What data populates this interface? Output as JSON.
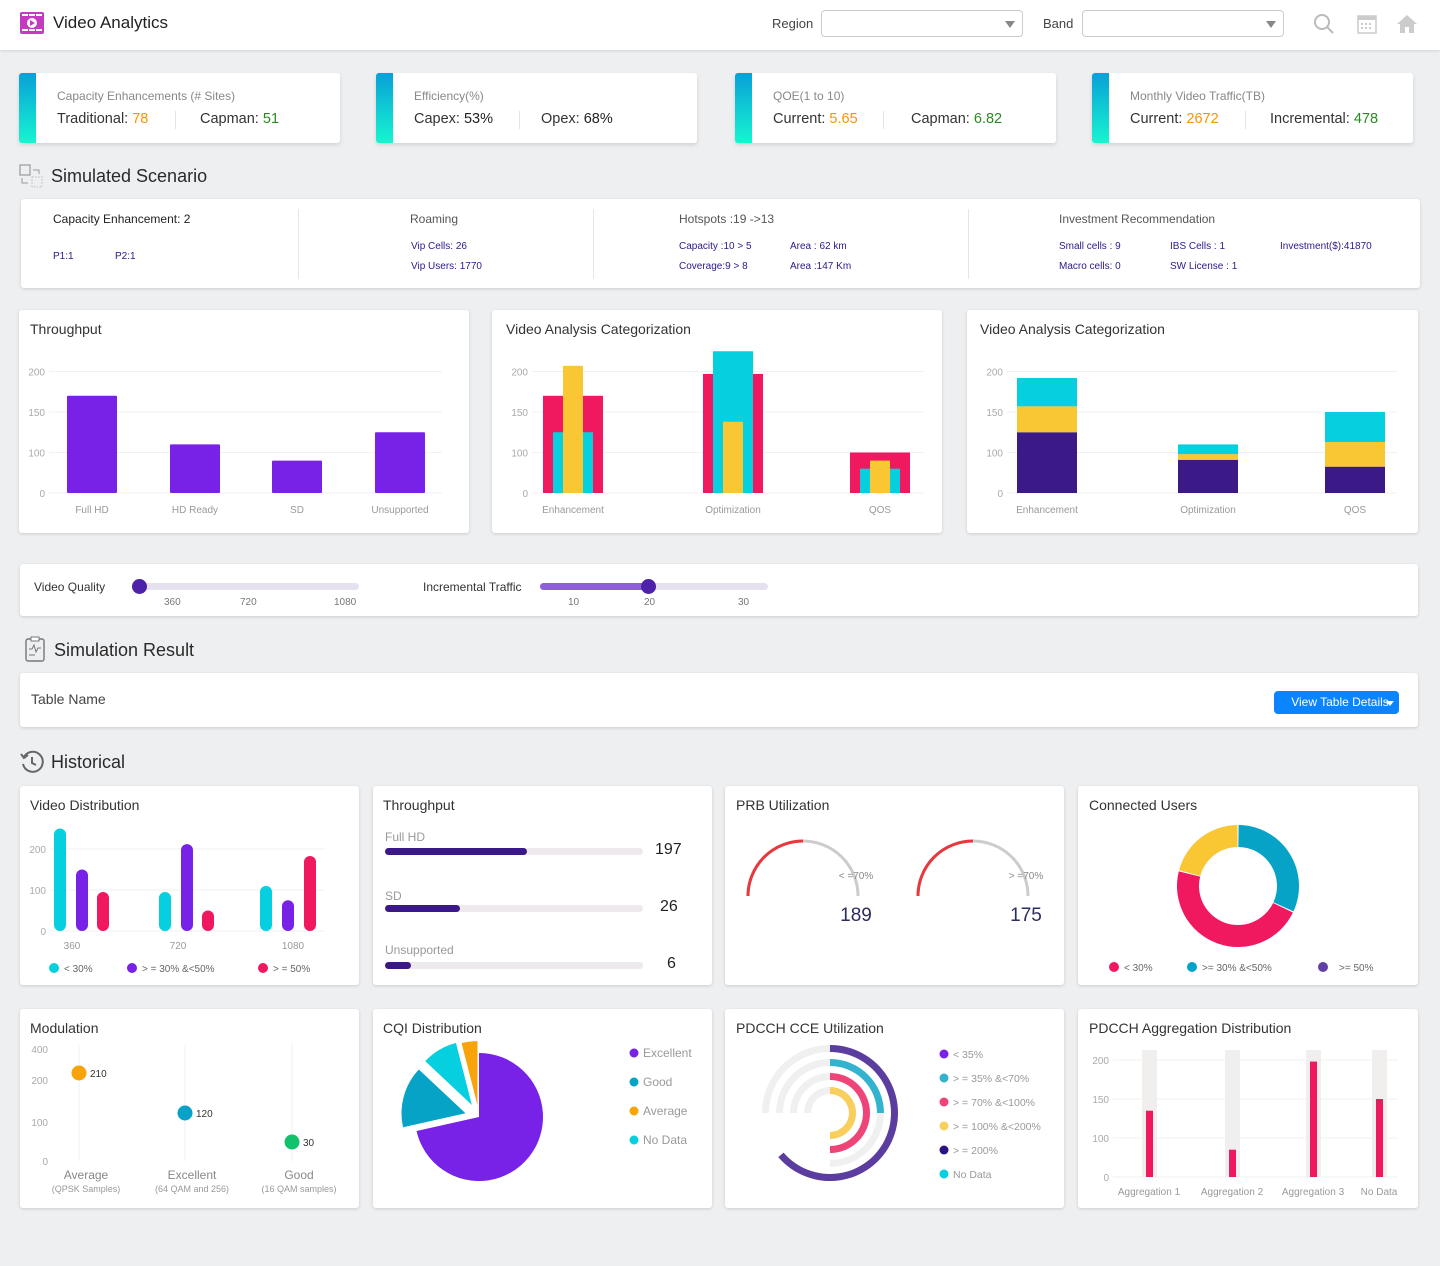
{
  "header": {
    "title": "Video Analytics",
    "region_label": "Region",
    "region_value": "",
    "band_label": "Band",
    "band_value": "",
    "icons": [
      "search-icon",
      "calendar-icon",
      "home-icon"
    ]
  },
  "kpis": [
    {
      "title": "Capacity Enhancements (# Sites)",
      "a_label": "Traditional:",
      "a_value": "78",
      "b_label": "Capman:",
      "b_value": "51"
    },
    {
      "title": "Efficiency(%)",
      "a_label": "Capex:",
      "a_value": "53%",
      "b_label": "Opex:",
      "b_value": "68%"
    },
    {
      "title": "QOE(1 to 10)",
      "a_label": "Current:",
      "a_value": "5.65",
      "b_label": "Capman:",
      "b_value": "6.82"
    },
    {
      "title": "Monthly Video Traffic(TB)",
      "a_label": "Current:",
      "a_value": "2672",
      "b_label": "Incremental:",
      "b_value": "478"
    }
  ],
  "colors": {
    "accent_orange": "#f7930a",
    "accent_green": "#2a8a1f",
    "purple": "#7722e6",
    "pink": "#f0195f",
    "cyan": "#06cfdf",
    "yellow": "#f9c634",
    "indigo": "#3b1a87",
    "button_blue": "#0a84ff"
  },
  "simulated": {
    "title": "Simulated Scenario",
    "capacity": {
      "heading": "Capacity Enhancement: 2",
      "p1": "P1:1",
      "p2": "P2:1"
    },
    "roaming": {
      "heading": "Roaming",
      "vip_cells": "Vip Cells: 26",
      "vip_users": "Vip Users: 1770"
    },
    "hotspots": {
      "heading": "Hotspots :19 ->13",
      "capacity": "Capacity :10 > 5",
      "area1": "Area : 62 km",
      "coverage": "Coverage:9 > 8",
      "area2": "Area :147 Km"
    },
    "investment": {
      "heading": "Investment Recommendation",
      "small": "Small cells : 9",
      "ibs": "IBS Cells : 1",
      "investment": "Investment($):41870",
      "macro": "Macro cells: 0",
      "sw": "SW License : 1"
    }
  },
  "sliders": {
    "video_quality": {
      "label": "Video Quality",
      "ticks": [
        "360",
        "720",
        "1080"
      ],
      "value_fraction": 0
    },
    "incremental_traffic": {
      "label": "Incremental Traffic",
      "ticks": [
        "10",
        "20",
        "30"
      ],
      "value": 20
    }
  },
  "simulation_result": {
    "title": "Simulation Result",
    "table_name": "Table Name",
    "button": "View Table Details"
  },
  "historical": {
    "title": "Historical"
  },
  "chart_data": [
    {
      "id": "throughput",
      "type": "bar",
      "title": "Throughput",
      "categories": [
        "Full HD",
        "HD Ready",
        "SD",
        "Unsupported"
      ],
      "values": [
        170,
        110,
        80,
        125
      ],
      "yticks": [
        "0",
        "100",
        "150",
        "200"
      ],
      "ylim": [
        0,
        200
      ]
    },
    {
      "id": "vac1",
      "type": "bar",
      "title": "Video Analysis Categorization",
      "categories": [
        "Enhancement",
        "Optimization",
        "QOS"
      ],
      "series": [
        {
          "name": "pink",
          "values": [
            170,
            197,
            100
          ]
        },
        {
          "name": "cyan",
          "values": [
            125,
            225,
            60
          ]
        },
        {
          "name": "yellow",
          "values": [
            207,
            138,
            80
          ]
        }
      ],
      "yticks": [
        "0",
        "100",
        "150",
        "200"
      ],
      "ylim": [
        0,
        200
      ]
    },
    {
      "id": "vac2",
      "type": "bar",
      "stacked": true,
      "title": "Video Analysis Categorization",
      "categories": [
        "Enhancement",
        "Optimization",
        "QOS"
      ],
      "series": [
        {
          "name": "indigo",
          "values": [
            125,
            82,
            65
          ]
        },
        {
          "name": "yellow",
          "values": [
            32,
            14,
            48
          ]
        },
        {
          "name": "cyan",
          "values": [
            35,
            14,
            37
          ]
        }
      ],
      "yticks": [
        "0",
        "100",
        "150",
        "200"
      ],
      "ylim": [
        0,
        200
      ]
    },
    {
      "id": "video_distribution",
      "type": "bar",
      "title": "Video Distribution",
      "categories": [
        "360",
        "720",
        "1080"
      ],
      "series": [
        {
          "name": "< 30%",
          "values": [
            250,
            95,
            110
          ]
        },
        {
          "name": ">= 30% &<50%",
          "values": [
            150,
            212,
            75
          ]
        },
        {
          "name": ">= 50%",
          "values": [
            95,
            50,
            183
          ]
        }
      ],
      "yticks": [
        "0",
        "100",
        "200"
      ],
      "ylim": [
        0,
        250
      ]
    },
    {
      "id": "throughput_hist",
      "type": "bar",
      "title": "Throughput",
      "categories": [
        "Full HD",
        "SD",
        "Unsupported"
      ],
      "values": [
        197,
        26,
        6
      ],
      "fill_fraction": [
        0.55,
        0.29,
        0.1
      ]
    },
    {
      "id": "prb",
      "type": "gauge",
      "title": "PRB Utilization",
      "gauges": [
        {
          "label": "< =70%",
          "value": "189",
          "fraction": 0.5
        },
        {
          "label": "> =70%",
          "value": "175",
          "fraction": 0.5
        }
      ]
    },
    {
      "id": "connected_users",
      "type": "pie",
      "title": "Connected Users",
      "labels": [
        "< 30%",
        ">= 30% &<50%",
        ">= 50%"
      ],
      "values": [
        47,
        32,
        21
      ],
      "legend": [
        "< 30%",
        ">= 30% &<50%",
        ">= 50%"
      ]
    },
    {
      "id": "modulation",
      "type": "scatter",
      "title": "Modulation",
      "categories": [
        "Average",
        "Excellent",
        "Good"
      ],
      "subtitles": [
        "(QPSK Samples)",
        "(64 QAM and 256)",
        "(16 QAM samples)"
      ],
      "values": [
        210,
        120,
        30
      ],
      "yticks": [
        "0",
        "100",
        "200",
        "400"
      ]
    },
    {
      "id": "cqi",
      "type": "pie",
      "title": "CQI Distribution",
      "labels": [
        "Excellent",
        "Good",
        "Average",
        "No Data"
      ],
      "values": [
        72,
        14,
        9,
        5
      ]
    },
    {
      "id": "pdcch_cce",
      "type": "pie",
      "title": "PDCCH CCE Utilization",
      "labels": [
        "< 35%",
        ">= 35% &<70%",
        ">= 70% &<100%",
        ">= 100% &<200%",
        ">= 200%",
        "No Data"
      ],
      "values": [
        0,
        25,
        50,
        45,
        60,
        0
      ]
    },
    {
      "id": "pdcch_agg",
      "type": "bar",
      "title": "PDCCH Aggregation Distribution",
      "categories": [
        "Aggregation 1",
        "Aggregation 2",
        "Aggregation 3",
        "No Data"
      ],
      "values": [
        135,
        70,
        198,
        150
      ],
      "yticks": [
        "0",
        "100",
        "150",
        "200"
      ],
      "ylim": [
        0,
        200
      ]
    }
  ]
}
